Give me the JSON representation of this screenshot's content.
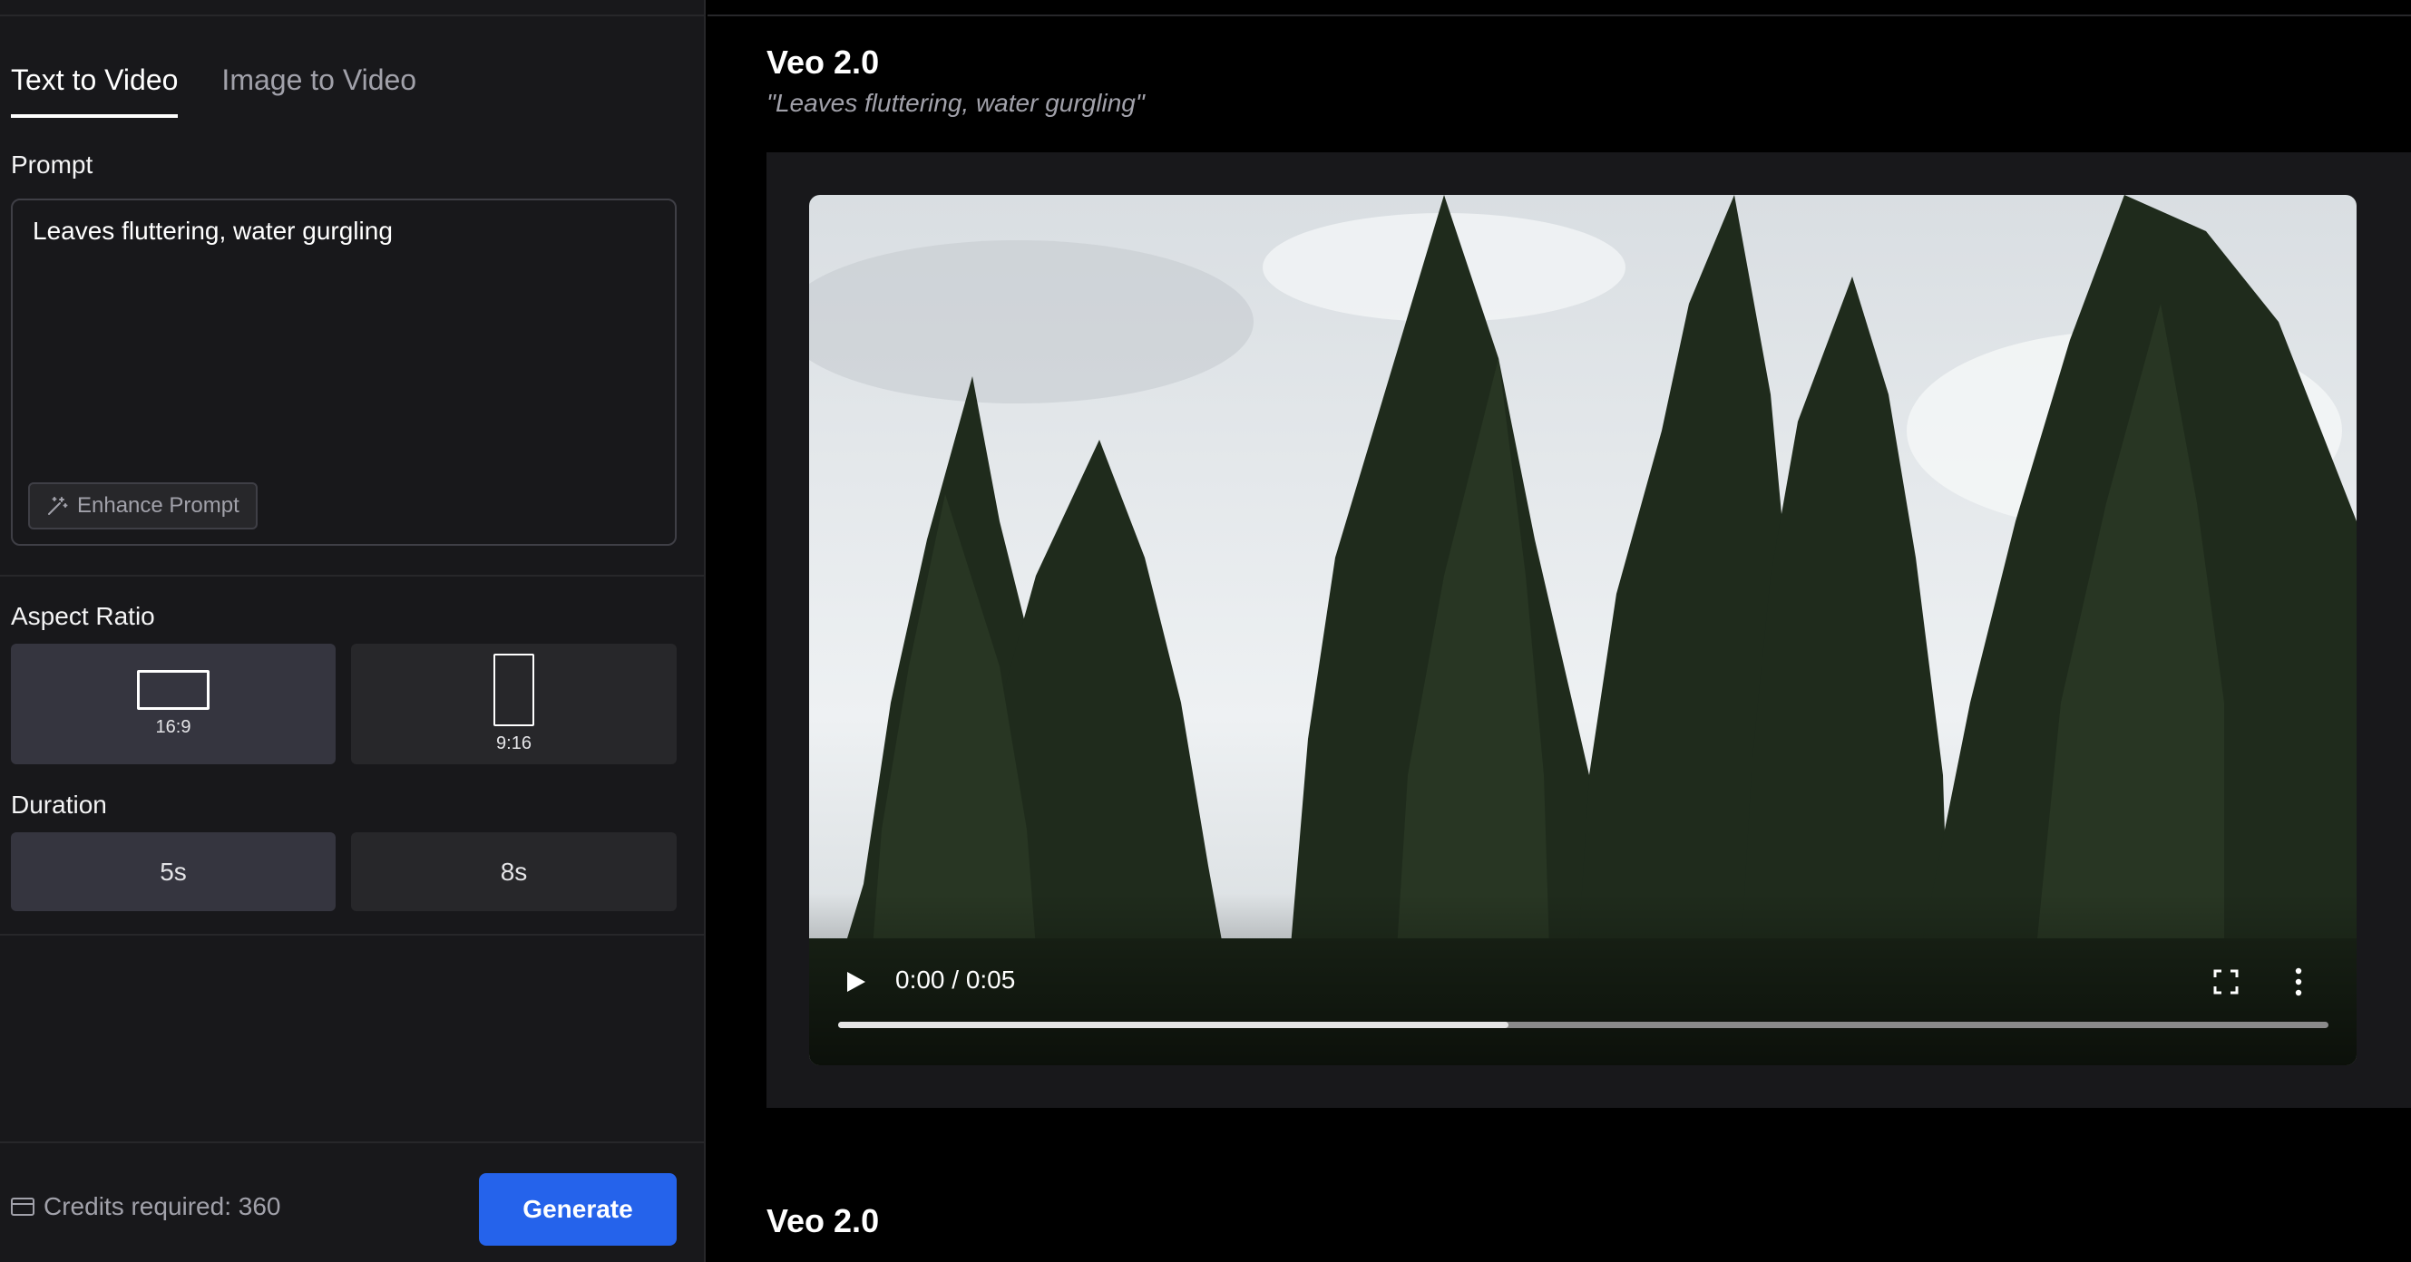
{
  "tabs": [
    {
      "label": "Text to Video",
      "active": true
    },
    {
      "label": "Image to Video",
      "active": false
    }
  ],
  "prompt": {
    "label": "Prompt",
    "value": "Leaves fluttering, water gurgling",
    "enhance_label": "Enhance Prompt",
    "enhance_icon": "magic-wand-icon"
  },
  "aspect_ratio": {
    "label": "Aspect Ratio",
    "options": [
      {
        "label": "16:9",
        "selected": true,
        "icon": "landscape-rect-icon"
      },
      {
        "label": "9:16",
        "selected": false,
        "icon": "portrait-rect-icon"
      }
    ]
  },
  "duration": {
    "label": "Duration",
    "options": [
      {
        "label": "5s",
        "selected": true
      },
      {
        "label": "8s",
        "selected": false
      }
    ]
  },
  "footer": {
    "credits_text": "Credits required: 360",
    "credits_icon": "credit-card-icon",
    "generate_label": "Generate",
    "generate_color": "#2563eb"
  },
  "results": [
    {
      "model": "Veo 2.0",
      "prompt_quote": "\"Leaves fluttering, water gurgling\"",
      "video": {
        "time_display": "0:00 / 0:05",
        "buffered_fraction": 0.45,
        "icons": [
          "play-icon",
          "fullscreen-icon",
          "more-vertical-icon"
        ]
      }
    },
    {
      "model": "Veo 2.0"
    }
  ]
}
